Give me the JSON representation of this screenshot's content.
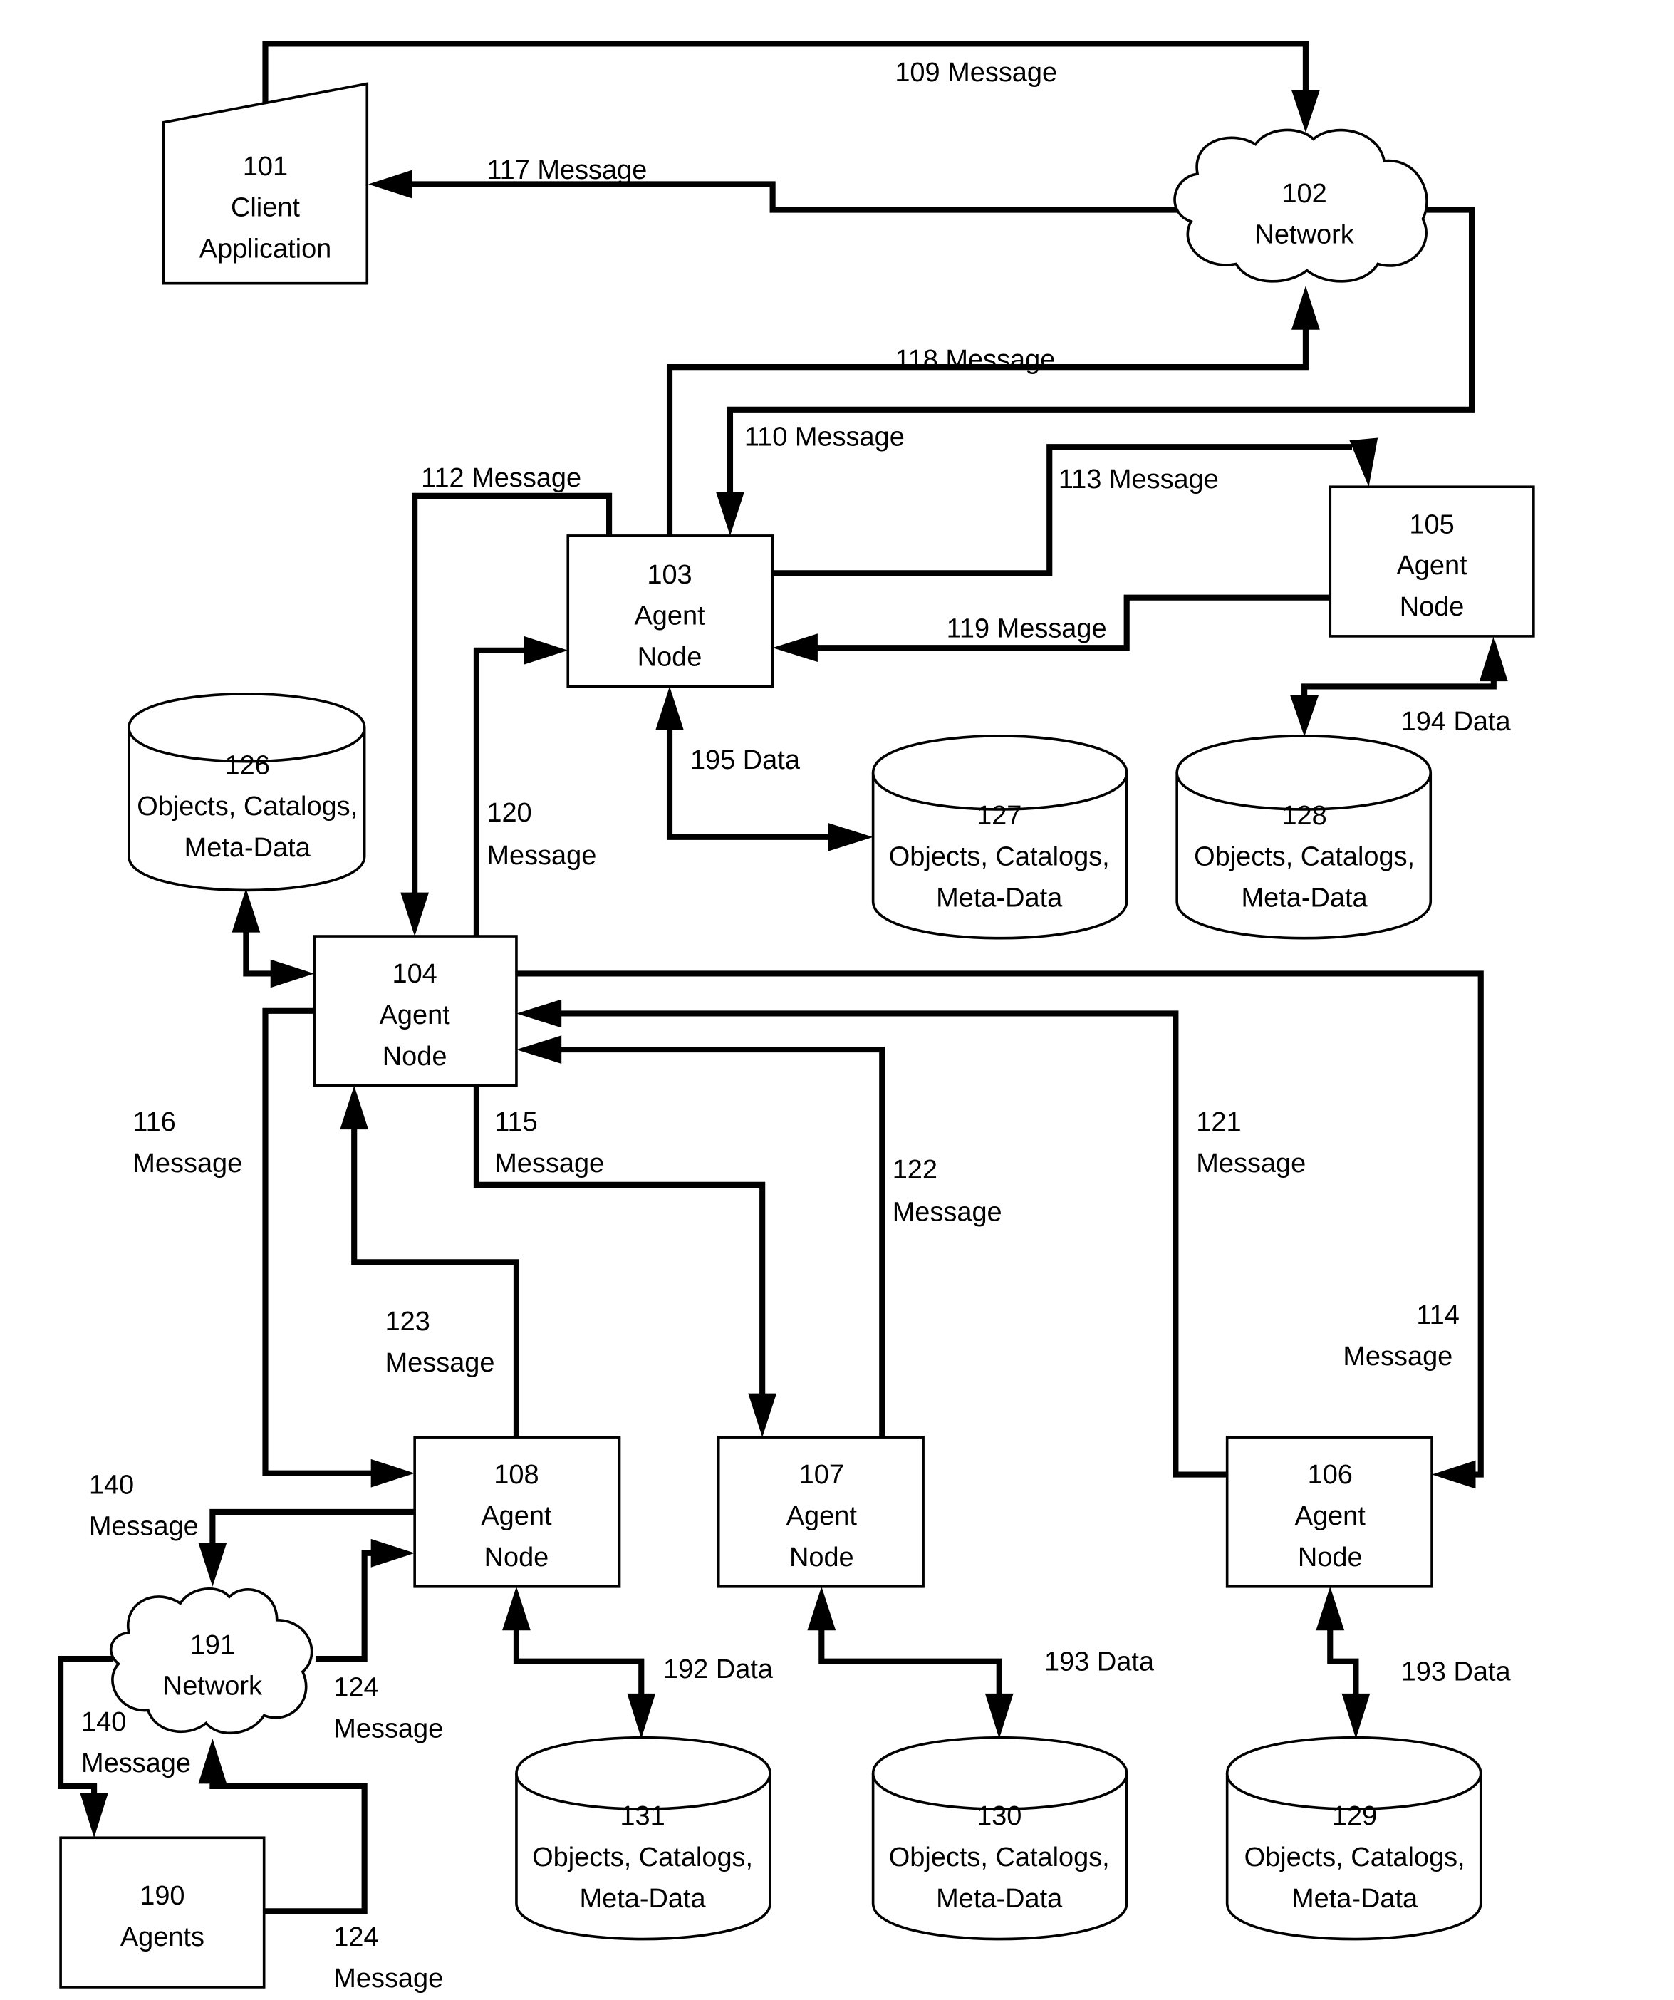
{
  "diagram": {
    "nodes": {
      "client": {
        "id": "101",
        "line1": "Client",
        "line2": "Application"
      },
      "net102": {
        "id": "102",
        "line1": "Network"
      },
      "n103": {
        "id": "103",
        "line1": "Agent",
        "line2": "Node"
      },
      "n104": {
        "id": "104",
        "line1": "Agent",
        "line2": "Node"
      },
      "n105": {
        "id": "105",
        "line1": "Agent",
        "line2": "Node"
      },
      "n106": {
        "id": "106",
        "line1": "Agent",
        "line2": "Node"
      },
      "n107": {
        "id": "107",
        "line1": "Agent",
        "line2": "Node"
      },
      "n108": {
        "id": "108",
        "line1": "Agent",
        "line2": "Node"
      },
      "agents190": {
        "id": "190",
        "line1": "Agents"
      },
      "net191": {
        "id": "191",
        "line1": "Network"
      }
    },
    "stores": {
      "s126": {
        "id": "126",
        "line1": "Objects, Catalogs,",
        "line2": "Meta-Data"
      },
      "s127": {
        "id": "127",
        "line1": "Objects, Catalogs,",
        "line2": "Meta-Data"
      },
      "s128": {
        "id": "128",
        "line1": "Objects, Catalogs,",
        "line2": "Meta-Data"
      },
      "s129": {
        "id": "129",
        "line1": "Objects, Catalogs,",
        "line2": "Meta-Data"
      },
      "s130": {
        "id": "130",
        "line1": "Objects, Catalogs,",
        "line2": "Meta-Data"
      },
      "s131": {
        "id": "131",
        "line1": "Objects, Catalogs,",
        "line2": "Meta-Data"
      }
    },
    "edges": {
      "m109": "109 Message",
      "m117": "117 Message",
      "m118": "118 Message",
      "m110": "110 Message",
      "m112": "112 Message",
      "m113": "113 Message",
      "m119": "119 Message",
      "d195": "195 Data",
      "d194": "194 Data",
      "m120a": "120",
      "m120b": "Message",
      "m116a": "116",
      "m116b": "Message",
      "m115a": "115",
      "m115b": "Message",
      "m122a": "122",
      "m122b": "Message",
      "m121a": "121",
      "m121b": "Message",
      "m114a": "114",
      "m114b": "Message",
      "m123a": "123",
      "m123b": "Message",
      "m140a": "140",
      "m140b": "Message",
      "m140c": "140",
      "m140d": "Message",
      "m124a": "124",
      "m124b": "Message",
      "m124c": "124",
      "m124d": "Message",
      "d192": "192 Data",
      "d193a": "193 Data",
      "d193b": "193 Data"
    }
  }
}
